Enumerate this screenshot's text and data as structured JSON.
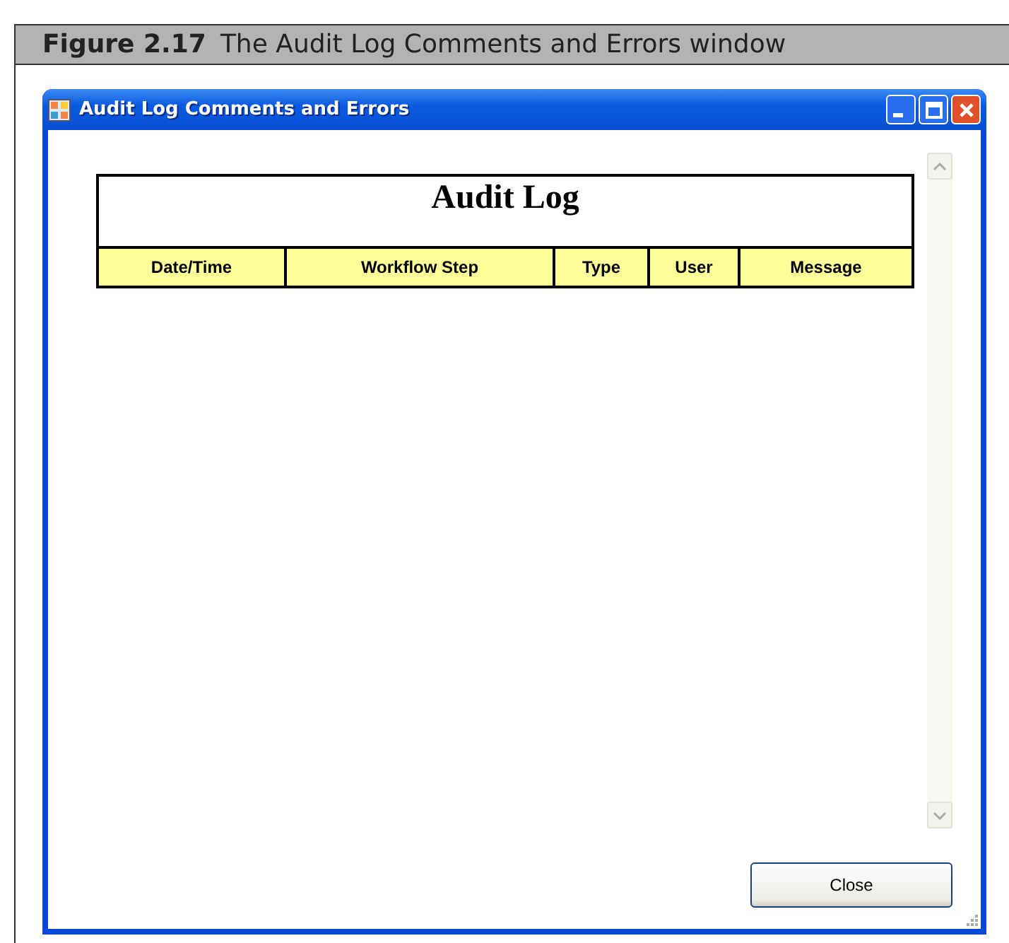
{
  "figure": {
    "label": "Figure 2.17",
    "caption": "The Audit Log Comments and Errors window"
  },
  "window": {
    "title": "Audit Log Comments and Errors"
  },
  "report": {
    "title": "Audit Log",
    "columns": [
      "Date/Time",
      "Workflow Step",
      "Type",
      "User",
      "Message"
    ]
  },
  "buttons": [
    "Close"
  ]
}
